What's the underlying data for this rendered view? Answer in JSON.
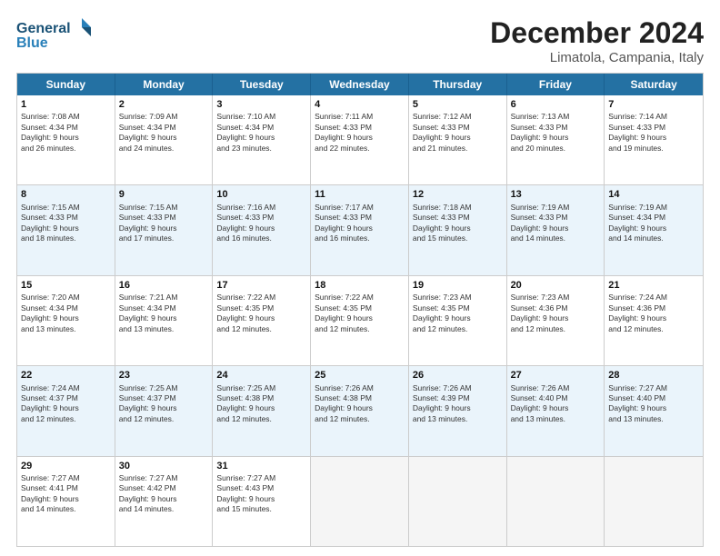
{
  "header": {
    "logo_general": "General",
    "logo_blue": "Blue",
    "month_title": "December 2024",
    "location": "Limatola, Campania, Italy"
  },
  "weekdays": [
    "Sunday",
    "Monday",
    "Tuesday",
    "Wednesday",
    "Thursday",
    "Friday",
    "Saturday"
  ],
  "rows": [
    [
      {
        "day": "1",
        "lines": [
          "Sunrise: 7:08 AM",
          "Sunset: 4:34 PM",
          "Daylight: 9 hours",
          "and 26 minutes."
        ]
      },
      {
        "day": "2",
        "lines": [
          "Sunrise: 7:09 AM",
          "Sunset: 4:34 PM",
          "Daylight: 9 hours",
          "and 24 minutes."
        ]
      },
      {
        "day": "3",
        "lines": [
          "Sunrise: 7:10 AM",
          "Sunset: 4:34 PM",
          "Daylight: 9 hours",
          "and 23 minutes."
        ]
      },
      {
        "day": "4",
        "lines": [
          "Sunrise: 7:11 AM",
          "Sunset: 4:33 PM",
          "Daylight: 9 hours",
          "and 22 minutes."
        ]
      },
      {
        "day": "5",
        "lines": [
          "Sunrise: 7:12 AM",
          "Sunset: 4:33 PM",
          "Daylight: 9 hours",
          "and 21 minutes."
        ]
      },
      {
        "day": "6",
        "lines": [
          "Sunrise: 7:13 AM",
          "Sunset: 4:33 PM",
          "Daylight: 9 hours",
          "and 20 minutes."
        ]
      },
      {
        "day": "7",
        "lines": [
          "Sunrise: 7:14 AM",
          "Sunset: 4:33 PM",
          "Daylight: 9 hours",
          "and 19 minutes."
        ]
      }
    ],
    [
      {
        "day": "8",
        "lines": [
          "Sunrise: 7:15 AM",
          "Sunset: 4:33 PM",
          "Daylight: 9 hours",
          "and 18 minutes."
        ]
      },
      {
        "day": "9",
        "lines": [
          "Sunrise: 7:15 AM",
          "Sunset: 4:33 PM",
          "Daylight: 9 hours",
          "and 17 minutes."
        ]
      },
      {
        "day": "10",
        "lines": [
          "Sunrise: 7:16 AM",
          "Sunset: 4:33 PM",
          "Daylight: 9 hours",
          "and 16 minutes."
        ]
      },
      {
        "day": "11",
        "lines": [
          "Sunrise: 7:17 AM",
          "Sunset: 4:33 PM",
          "Daylight: 9 hours",
          "and 16 minutes."
        ]
      },
      {
        "day": "12",
        "lines": [
          "Sunrise: 7:18 AM",
          "Sunset: 4:33 PM",
          "Daylight: 9 hours",
          "and 15 minutes."
        ]
      },
      {
        "day": "13",
        "lines": [
          "Sunrise: 7:19 AM",
          "Sunset: 4:33 PM",
          "Daylight: 9 hours",
          "and 14 minutes."
        ]
      },
      {
        "day": "14",
        "lines": [
          "Sunrise: 7:19 AM",
          "Sunset: 4:34 PM",
          "Daylight: 9 hours",
          "and 14 minutes."
        ]
      }
    ],
    [
      {
        "day": "15",
        "lines": [
          "Sunrise: 7:20 AM",
          "Sunset: 4:34 PM",
          "Daylight: 9 hours",
          "and 13 minutes."
        ]
      },
      {
        "day": "16",
        "lines": [
          "Sunrise: 7:21 AM",
          "Sunset: 4:34 PM",
          "Daylight: 9 hours",
          "and 13 minutes."
        ]
      },
      {
        "day": "17",
        "lines": [
          "Sunrise: 7:22 AM",
          "Sunset: 4:35 PM",
          "Daylight: 9 hours",
          "and 12 minutes."
        ]
      },
      {
        "day": "18",
        "lines": [
          "Sunrise: 7:22 AM",
          "Sunset: 4:35 PM",
          "Daylight: 9 hours",
          "and 12 minutes."
        ]
      },
      {
        "day": "19",
        "lines": [
          "Sunrise: 7:23 AM",
          "Sunset: 4:35 PM",
          "Daylight: 9 hours",
          "and 12 minutes."
        ]
      },
      {
        "day": "20",
        "lines": [
          "Sunrise: 7:23 AM",
          "Sunset: 4:36 PM",
          "Daylight: 9 hours",
          "and 12 minutes."
        ]
      },
      {
        "day": "21",
        "lines": [
          "Sunrise: 7:24 AM",
          "Sunset: 4:36 PM",
          "Daylight: 9 hours",
          "and 12 minutes."
        ]
      }
    ],
    [
      {
        "day": "22",
        "lines": [
          "Sunrise: 7:24 AM",
          "Sunset: 4:37 PM",
          "Daylight: 9 hours",
          "and 12 minutes."
        ]
      },
      {
        "day": "23",
        "lines": [
          "Sunrise: 7:25 AM",
          "Sunset: 4:37 PM",
          "Daylight: 9 hours",
          "and 12 minutes."
        ]
      },
      {
        "day": "24",
        "lines": [
          "Sunrise: 7:25 AM",
          "Sunset: 4:38 PM",
          "Daylight: 9 hours",
          "and 12 minutes."
        ]
      },
      {
        "day": "25",
        "lines": [
          "Sunrise: 7:26 AM",
          "Sunset: 4:38 PM",
          "Daylight: 9 hours",
          "and 12 minutes."
        ]
      },
      {
        "day": "26",
        "lines": [
          "Sunrise: 7:26 AM",
          "Sunset: 4:39 PM",
          "Daylight: 9 hours",
          "and 13 minutes."
        ]
      },
      {
        "day": "27",
        "lines": [
          "Sunrise: 7:26 AM",
          "Sunset: 4:40 PM",
          "Daylight: 9 hours",
          "and 13 minutes."
        ]
      },
      {
        "day": "28",
        "lines": [
          "Sunrise: 7:27 AM",
          "Sunset: 4:40 PM",
          "Daylight: 9 hours",
          "and 13 minutes."
        ]
      }
    ],
    [
      {
        "day": "29",
        "lines": [
          "Sunrise: 7:27 AM",
          "Sunset: 4:41 PM",
          "Daylight: 9 hours",
          "and 14 minutes."
        ]
      },
      {
        "day": "30",
        "lines": [
          "Sunrise: 7:27 AM",
          "Sunset: 4:42 PM",
          "Daylight: 9 hours",
          "and 14 minutes."
        ]
      },
      {
        "day": "31",
        "lines": [
          "Sunrise: 7:27 AM",
          "Sunset: 4:43 PM",
          "Daylight: 9 hours",
          "and 15 minutes."
        ]
      },
      null,
      null,
      null,
      null
    ]
  ]
}
